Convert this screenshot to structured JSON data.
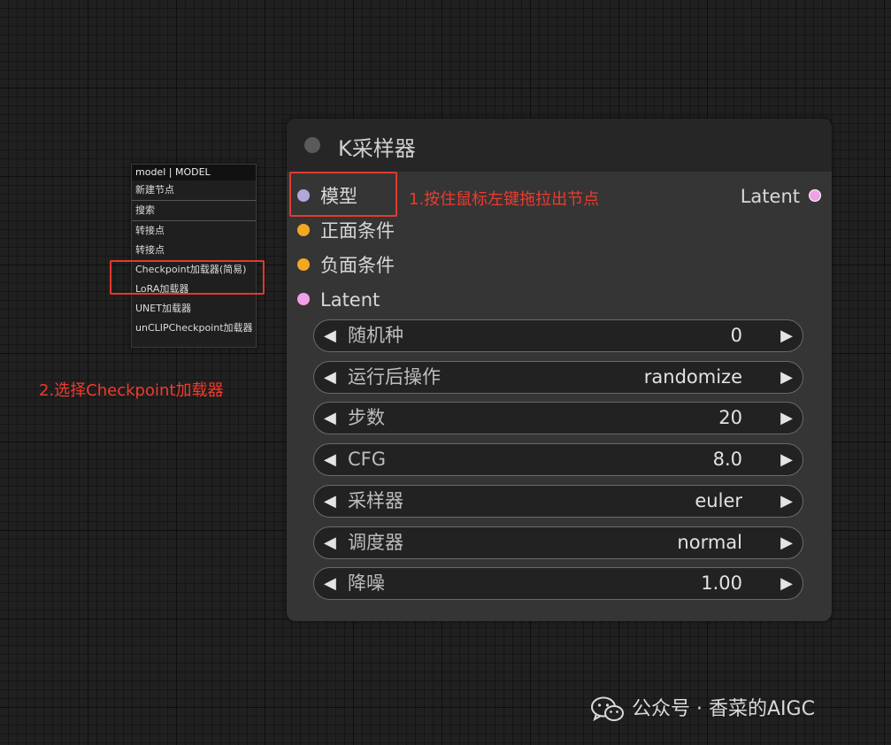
{
  "context_menu": {
    "title": "model | MODEL",
    "items": [
      {
        "label": "新建节点"
      },
      {
        "label": "搜索"
      },
      {
        "label": "转接点"
      },
      {
        "label": "转接点"
      },
      {
        "label": "Checkpoint加载器(简易)"
      },
      {
        "label": "LoRA加载器"
      },
      {
        "label": "UNET加载器"
      },
      {
        "label": "unCLIPCheckpoint加载器"
      }
    ]
  },
  "annotations": {
    "step1": "1.按住鼠标左键拖拉出节点",
    "step2": "2.选择Checkpoint加载器",
    "color": "#ee3b2e"
  },
  "node": {
    "title": "K采样器",
    "inputs": [
      {
        "label": "模型",
        "color": "#b3a6d8"
      },
      {
        "label": "正面条件",
        "color": "#f5a623"
      },
      {
        "label": "负面条件",
        "color": "#f5a623"
      },
      {
        "label": "Latent",
        "color": "#f0a0e8"
      }
    ],
    "output": {
      "label": "Latent",
      "color": "#f0a0e8"
    },
    "widgets": [
      {
        "label": "随机种",
        "value": "0"
      },
      {
        "label": "运行后操作",
        "value": "randomize"
      },
      {
        "label": "步数",
        "value": "20"
      },
      {
        "label": "CFG",
        "value": "8.0"
      },
      {
        "label": "采样器",
        "value": "euler"
      },
      {
        "label": "调度器",
        "value": "normal"
      },
      {
        "label": "降噪",
        "value": "1.00"
      }
    ],
    "arrow_left": "◀",
    "arrow_right": "▶"
  },
  "watermark": {
    "text": "公众号 · 香菜的AIGC",
    "icon": "wechat-icon"
  }
}
